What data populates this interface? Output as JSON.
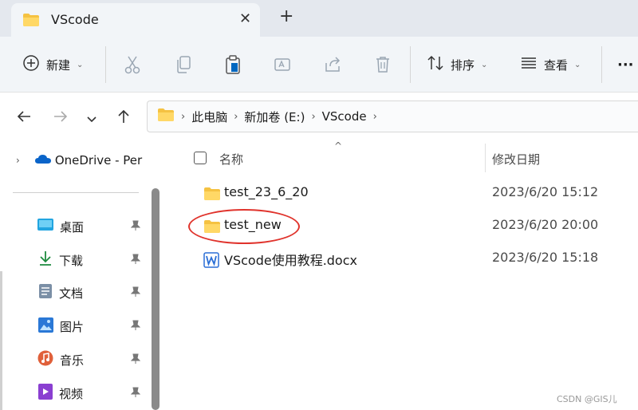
{
  "window": {
    "tab_title": "VScode",
    "close_glyph": "✕",
    "new_tab_glyph": "+"
  },
  "toolbar": {
    "new_label": "新建",
    "sort_label": "排序",
    "view_label": "查看",
    "more_label": "···",
    "icons": [
      "new-icon",
      "cut-icon",
      "copy-icon",
      "paste-icon",
      "rename-icon",
      "share-icon",
      "delete-icon",
      "sort-icon",
      "view-icon"
    ]
  },
  "address": {
    "segments": [
      "此电脑",
      "新加卷 (E:)",
      "VScode"
    ],
    "separator": "›"
  },
  "sidebar": {
    "onedrive_label": "OneDrive - Per",
    "items": [
      {
        "label": "桌面",
        "icon": "desktop-icon"
      },
      {
        "label": "下载",
        "icon": "download-icon"
      },
      {
        "label": "文档",
        "icon": "documents-icon"
      },
      {
        "label": "图片",
        "icon": "pictures-icon"
      },
      {
        "label": "音乐",
        "icon": "music-icon"
      },
      {
        "label": "视频",
        "icon": "videos-icon"
      }
    ]
  },
  "filelist": {
    "columns": [
      "名称",
      "修改日期"
    ],
    "rows": [
      {
        "name": "test_23_6_20",
        "date": "2023/6/20 15:12",
        "type": "folder"
      },
      {
        "name": "test_new",
        "date": "2023/6/20 20:00",
        "type": "folder"
      },
      {
        "name": "VScode使用教程.docx",
        "date": "2023/6/20 15:18",
        "type": "docx"
      }
    ]
  },
  "watermark": "CSDN @GIS儿",
  "colors": {
    "folder": "#f5c242",
    "accent": "#0067c0",
    "highlight": "#e0332c"
  }
}
